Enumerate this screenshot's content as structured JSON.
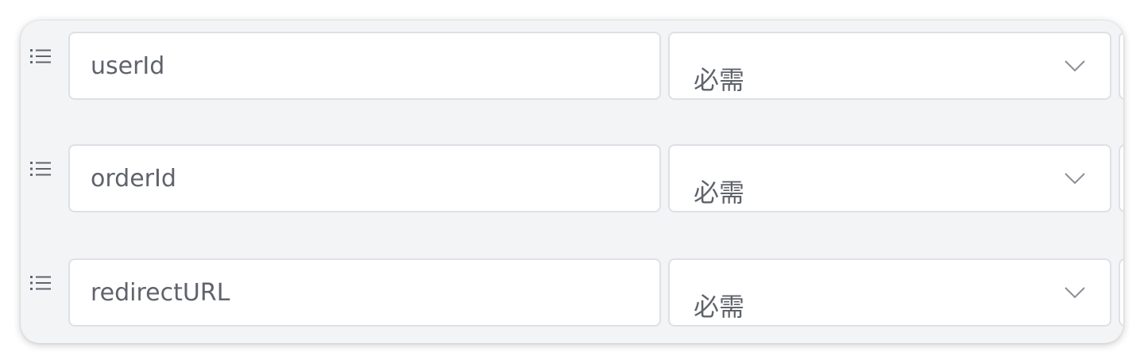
{
  "params": [
    {
      "name": "userId",
      "requirement": "必需"
    },
    {
      "name": "orderId",
      "requirement": "必需"
    },
    {
      "name": "redirectURL",
      "requirement": "必需"
    }
  ],
  "icons": {
    "drag": "list-drag-icon",
    "dropdown": "chevron-down-icon"
  },
  "colors": {
    "background": "#f3f4f6",
    "field_border": "#dde0e5",
    "text": "#5f636b"
  }
}
